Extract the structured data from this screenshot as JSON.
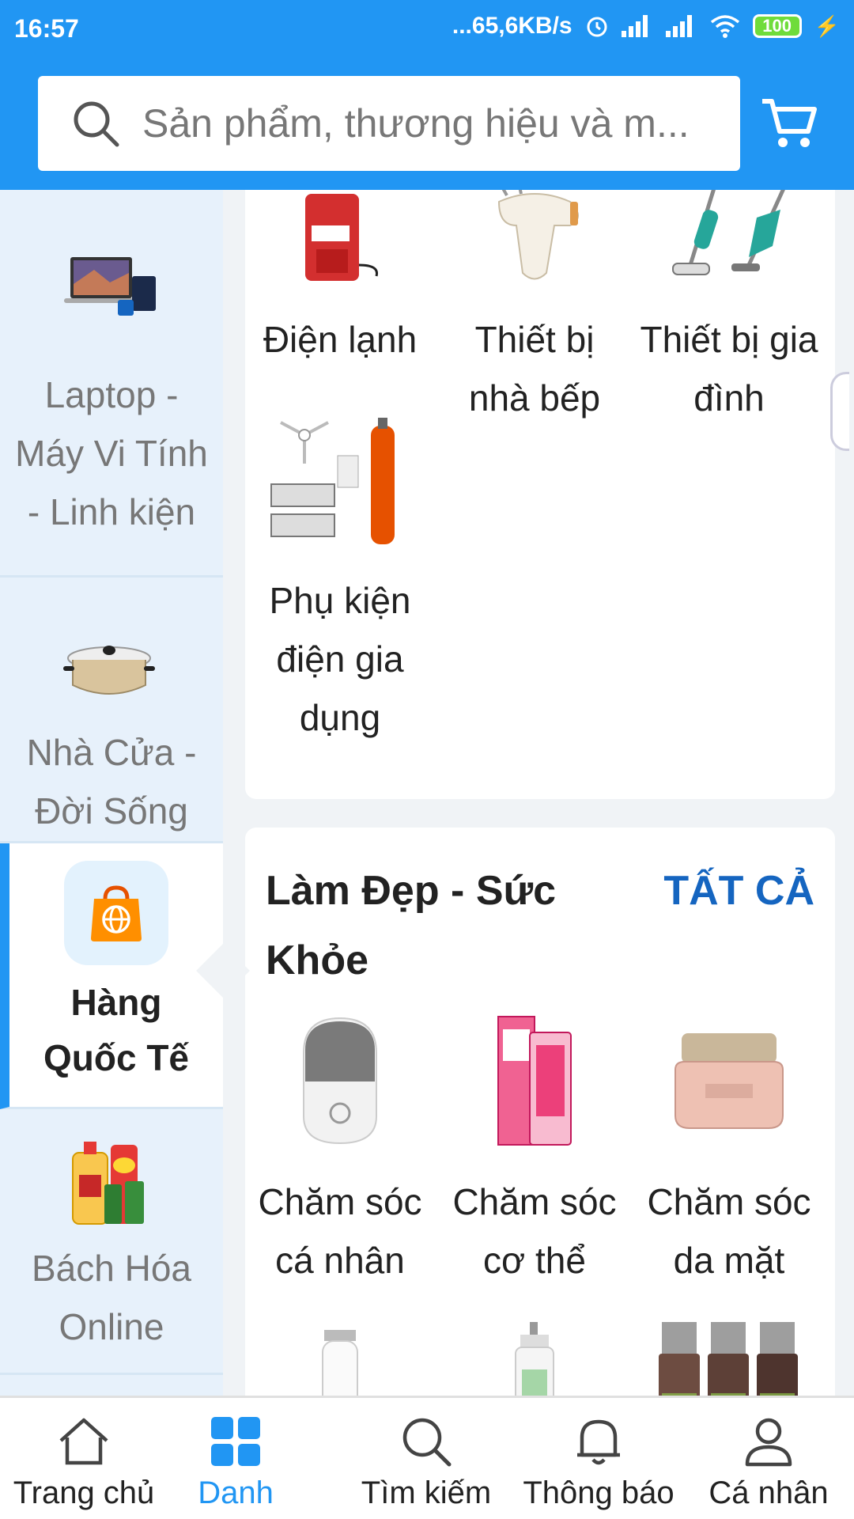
{
  "status_bar": {
    "time": "16:57",
    "net_speed": "...65,6KB/s",
    "battery": "100"
  },
  "search": {
    "placeholder": "Sản phẩm, thương hiệu và m..."
  },
  "sidebar": {
    "items": [
      {
        "label": "Laptop - Máy Vi Tính - Linh kiện",
        "icon": "laptop-icon",
        "active": false
      },
      {
        "label": "Nhà Cửa - Đời Sống",
        "icon": "cookware-icon",
        "active": false
      },
      {
        "label": "Hàng Quốc Tế",
        "icon": "global-shopping-bag-icon",
        "active": true
      },
      {
        "label": "Bách Hóa Online",
        "icon": "grocery-icon",
        "active": false
      }
    ]
  },
  "appliances_card": {
    "tiles": [
      {
        "name": "Điện lạnh",
        "icon": "mini-fridge-icon"
      },
      {
        "name": "Thiết bị nhà bếp",
        "icon": "hand-mixer-icon"
      },
      {
        "name": "Thiết bị gia đình",
        "icon": "vacuum-cleaner-icon"
      },
      {
        "name": "Phụ kiện điện gia dụng",
        "icon": "robot-vacuum-parts-icon"
      }
    ]
  },
  "beauty_card": {
    "title": "Làm Đẹp - Sức Khỏe",
    "see_all": "TẤT CẢ",
    "tiles": [
      {
        "name": "Chăm sóc cá nhân",
        "icon": "face-cleanser-icon"
      },
      {
        "name": "Chăm sóc cơ thể",
        "icon": "cream-tubes-icon"
      },
      {
        "name": "Chăm sóc da mặt",
        "icon": "face-cream-jar-icon"
      },
      {
        "name": "",
        "icon": "hair-clipper-icon"
      },
      {
        "name": "",
        "icon": "lotion-bottle-icon"
      },
      {
        "name": "",
        "icon": "essential-oils-icon"
      }
    ]
  },
  "bottom_nav": {
    "items": [
      {
        "label": "Trang chủ",
        "icon": "home-icon"
      },
      {
        "label": "Danh",
        "icon": "grid-icon",
        "active": true
      },
      {
        "label": "Tìm kiếm",
        "icon": "search-icon"
      },
      {
        "label": "Thông báo",
        "icon": "bell-icon"
      },
      {
        "label": "Cá nhân",
        "icon": "user-icon"
      }
    ]
  },
  "colors": {
    "primary": "#2196f3",
    "link": "#1565c0",
    "sidebar_bg": "#e7f1fb"
  }
}
